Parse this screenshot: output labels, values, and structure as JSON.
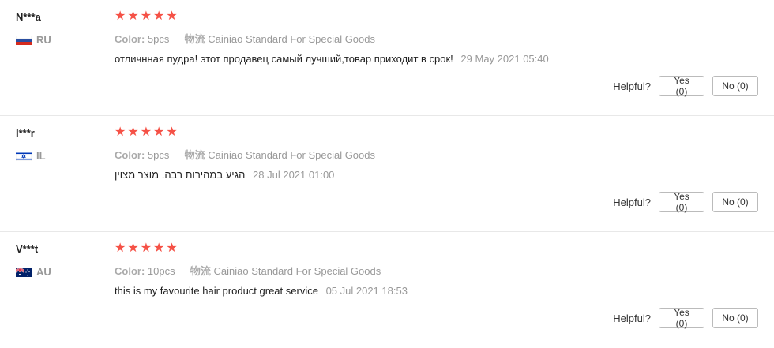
{
  "helpful_label": "Helpful?",
  "reviews": [
    {
      "user": "N***a",
      "country": "RU",
      "flag": "ru",
      "stars": 5,
      "color_label": "Color:",
      "color_value": "5pcs",
      "shipping_label": "物流",
      "shipping_value": "Cainiao Standard For Special Goods",
      "text": "отличнная пудра! этот продавец самый лучший,товар приходит в срок!",
      "date": "29 May 2021 05:40",
      "yes": "Yes (0)",
      "no": "No (0)"
    },
    {
      "user": "I***r",
      "country": "IL",
      "flag": "il",
      "stars": 5,
      "color_label": "Color:",
      "color_value": "5pcs",
      "shipping_label": "物流",
      "shipping_value": "Cainiao Standard For Special Goods",
      "text": "הגיע במהירות רבה. מוצר מצוין",
      "date": "28 Jul 2021 01:00",
      "yes": "Yes (0)",
      "no": "No (0)"
    },
    {
      "user": "V***t",
      "country": "AU",
      "flag": "au",
      "stars": 5,
      "color_label": "Color:",
      "color_value": "10pcs",
      "shipping_label": "物流",
      "shipping_value": "Cainiao Standard For Special Goods",
      "text": "this is my favourite hair product great service",
      "date": "05 Jul 2021 18:53",
      "yes": "Yes (0)",
      "no": "No (0)"
    }
  ],
  "colors": {
    "star": "#f55146",
    "muted": "#999999"
  }
}
